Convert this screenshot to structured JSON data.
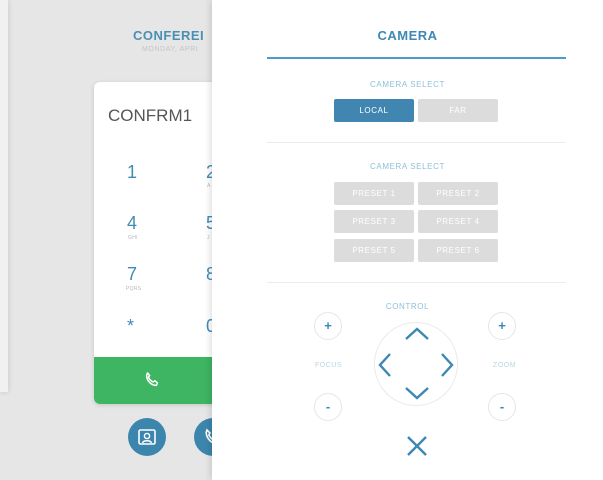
{
  "background": {
    "conference_title": "CONFEREI",
    "conference_date": "MONDAY, APRI",
    "dialer_name": "CONFRM1",
    "keys": [
      {
        "digit": "1",
        "letters": ""
      },
      {
        "digit": "2",
        "letters": "A"
      },
      {
        "digit": "4",
        "letters": "GHI"
      },
      {
        "digit": "5",
        "letters": "J"
      },
      {
        "digit": "7",
        "letters": "PQRS"
      },
      {
        "digit": "8",
        "letters": ""
      },
      {
        "digit": "*",
        "letters": ""
      },
      {
        "digit": "0",
        "letters": ""
      }
    ],
    "colors": {
      "call_green": "#3db562",
      "accent_blue": "#3f8cb6"
    }
  },
  "camera_panel": {
    "title": "CAMERA",
    "camera_select_label": "CAMERA SELECT",
    "camera_buttons": [
      {
        "label": "LOCAL",
        "active": true
      },
      {
        "label": "FAR",
        "active": false
      }
    ],
    "preset_section_label": "CAMERA SELECT",
    "presets": [
      "PRESET 1",
      "PRESET 2",
      "PRESET 3",
      "PRESET 4",
      "PRESET 5",
      "PRESET 6"
    ],
    "control_label": "CONTROL",
    "focus_label": "FOCUS",
    "zoom_label": "ZOOM",
    "plus": "+",
    "minus": "-",
    "icons": [
      "chevron-up-icon",
      "chevron-down-icon",
      "chevron-left-icon",
      "chevron-right-icon",
      "close-icon",
      "phone-icon"
    ]
  }
}
